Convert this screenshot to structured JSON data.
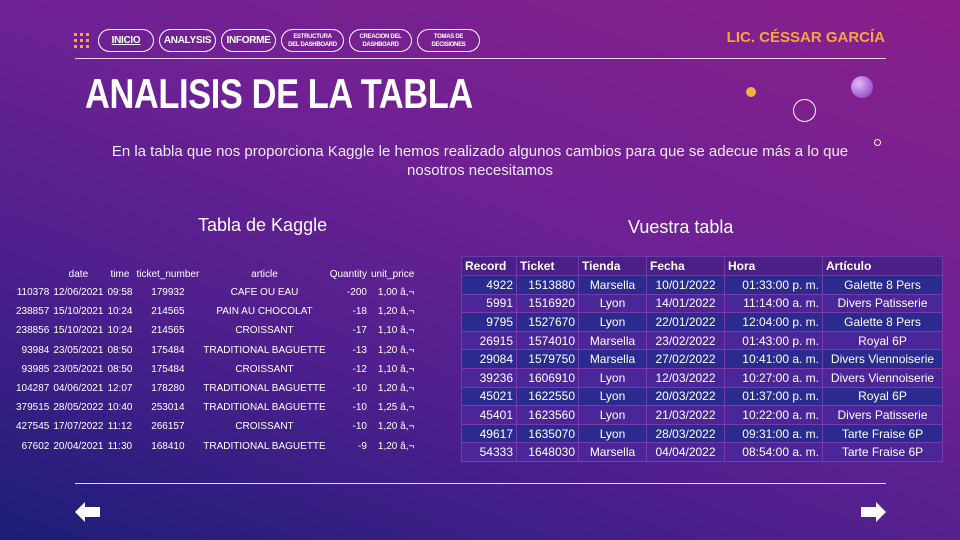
{
  "header": {
    "nav": [
      {
        "label": "INICIO",
        "active": true,
        "small": false,
        "width": 56
      },
      {
        "label": "ANALYSIS",
        "active": false,
        "small": false,
        "width": 57
      },
      {
        "label": "INFORME",
        "active": false,
        "small": false,
        "width": 55
      },
      {
        "label": "ESTRUCTURA DEL DASHBOARD",
        "active": false,
        "small": true,
        "width": 63
      },
      {
        "label": "CREACION DEL DASHBOARD",
        "active": false,
        "small": true,
        "width": 63
      },
      {
        "label": "TOMAS DE DECISIONES",
        "active": false,
        "small": true,
        "width": 63
      }
    ],
    "brand": "LIC. CÉSSAR GARCÍA",
    "accent_color": "#f5a545"
  },
  "page": {
    "title": "ANALISIS DE LA TABLA",
    "intro": "En la tabla que nos proporciona Kaggle le hemos realizado algunos cambios para que se adecue más a lo que nosotros necesitamos"
  },
  "kaggle_table": {
    "title": "Tabla de Kaggle",
    "columns": [
      "",
      "date",
      "time",
      "ticket_number",
      "article",
      "Quantity",
      "unit_price"
    ],
    "rows": [
      [
        "110378",
        "12/06/2021",
        "09:58",
        "179932",
        "CAFE OU EAU",
        "-200",
        "1,00 â,¬"
      ],
      [
        "238857",
        "15/10/2021",
        "10:24",
        "214565",
        "PAIN AU CHOCOLAT",
        "-18",
        "1,20 â,¬"
      ],
      [
        "238856",
        "15/10/2021",
        "10:24",
        "214565",
        "CROISSANT",
        "-17",
        "1,10 â,¬"
      ],
      [
        "93984",
        "23/05/2021",
        "08:50",
        "175484",
        "TRADITIONAL BAGUETTE",
        "-13",
        "1,20 â,¬"
      ],
      [
        "93985",
        "23/05/2021",
        "08:50",
        "175484",
        "CROISSANT",
        "-12",
        "1,10 â,¬"
      ],
      [
        "104287",
        "04/06/2021",
        "12:07",
        "178280",
        "TRADITIONAL BAGUETTE",
        "-10",
        "1,20 â,¬"
      ],
      [
        "379515",
        "28/05/2022",
        "10:40",
        "253014",
        "TRADITIONAL BAGUETTE",
        "-10",
        "1,25 â,¬"
      ],
      [
        "427545",
        "17/07/2022",
        "11:12",
        "266157",
        "CROISSANT",
        "-10",
        "1,20 â,¬"
      ],
      [
        "67602",
        "20/04/2021",
        "11:30",
        "168410",
        "TRADITIONAL BAGUETTE",
        "-9",
        "1,20 â,¬"
      ]
    ]
  },
  "our_table": {
    "title": "Vuestra tabla",
    "columns": [
      "Record",
      "Ticket",
      "Tienda",
      "Fecha",
      "Hora",
      "Artículo"
    ],
    "rows": [
      [
        "4922",
        "1513880",
        "Marsella",
        "10/01/2022",
        "01:33:00 p. m.",
        "Galette 8 Pers"
      ],
      [
        "5991",
        "1516920",
        "Lyon",
        "14/01/2022",
        "11:14:00 a. m.",
        "Divers Patisserie"
      ],
      [
        "9795",
        "1527670",
        "Lyon",
        "22/01/2022",
        "12:04:00 p. m.",
        "Galette 8 Pers"
      ],
      [
        "26915",
        "1574010",
        "Marsella",
        "23/02/2022",
        "01:43:00 p. m.",
        "Royal 6P"
      ],
      [
        "29084",
        "1579750",
        "Marsella",
        "27/02/2022",
        "10:41:00 a. m.",
        "Divers Viennoiserie"
      ],
      [
        "39236",
        "1606910",
        "Lyon",
        "12/03/2022",
        "10:27:00 a. m.",
        "Divers Viennoiserie"
      ],
      [
        "45021",
        "1622550",
        "Lyon",
        "20/03/2022",
        "01:37:00 p. m.",
        "Royal 6P"
      ],
      [
        "45401",
        "1623560",
        "Lyon",
        "21/03/2022",
        "10:22:00 a. m.",
        "Divers Patisserie"
      ],
      [
        "49617",
        "1635070",
        "Lyon",
        "28/03/2022",
        "09:31:00 a. m.",
        "Tarte Fraise 6P"
      ],
      [
        "54333",
        "1648030",
        "Marsella",
        "04/04/2022",
        "08:54:00 a. m.",
        "Tarte Fraise 6P"
      ]
    ]
  },
  "footer": {
    "prev_icon": "arrow-left-icon",
    "next_icon": "arrow-right-icon"
  }
}
